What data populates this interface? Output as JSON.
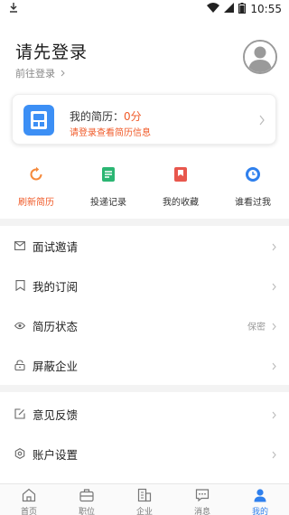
{
  "status_bar": {
    "time": "10:55"
  },
  "profile": {
    "title": "请先登录",
    "subtitle": "前往登录"
  },
  "resume_card": {
    "title": "我的简历：",
    "score": "0分",
    "hint": "请登录查看简历信息"
  },
  "quick_actions": [
    {
      "label": "刷新简历",
      "icon": "refresh-icon",
      "color": "#f5893b",
      "active": true
    },
    {
      "label": "投递记录",
      "icon": "document-icon",
      "color": "#2bb673",
      "active": false
    },
    {
      "label": "我的收藏",
      "icon": "bookmark-icon",
      "color": "#e8574d",
      "active": false
    },
    {
      "label": "谁看过我",
      "icon": "clock-icon",
      "color": "#2f80ed",
      "active": false
    }
  ],
  "menu_group_1": [
    {
      "label": "面试邀请",
      "icon": "mail-icon",
      "value": ""
    },
    {
      "label": "我的订阅",
      "icon": "bookmark-outline-icon",
      "value": ""
    },
    {
      "label": "简历状态",
      "icon": "eye-icon",
      "value": "保密"
    },
    {
      "label": "屏蔽企业",
      "icon": "lock-icon",
      "value": ""
    }
  ],
  "menu_group_2": [
    {
      "label": "意见反馈",
      "icon": "edit-icon",
      "value": ""
    },
    {
      "label": "账户设置",
      "icon": "gear-icon",
      "value": ""
    }
  ],
  "tab_bar": [
    {
      "label": "首页",
      "icon": "home-icon",
      "active": false
    },
    {
      "label": "职位",
      "icon": "briefcase-icon",
      "active": false
    },
    {
      "label": "企业",
      "icon": "building-icon",
      "active": false
    },
    {
      "label": "消息",
      "icon": "message-icon",
      "active": false
    },
    {
      "label": "我的",
      "icon": "user-icon",
      "active": true
    }
  ],
  "colors": {
    "accent": "#2f80ed",
    "warning": "#f05a28"
  }
}
